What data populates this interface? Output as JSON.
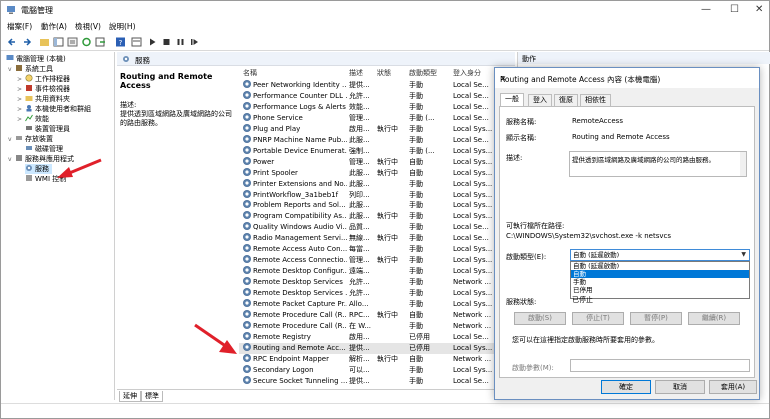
{
  "window": {
    "title": "電腦管理"
  },
  "menu": [
    "檔案(F)",
    "動作(A)",
    "檢視(V)",
    "說明(H)"
  ],
  "tree": [
    {
      "label": "電腦管理 (本機)",
      "indent": 0,
      "caret": ""
    },
    {
      "label": "系統工具",
      "indent": 1,
      "caret": "v"
    },
    {
      "label": "工作排程器",
      "indent": 2,
      "caret": ">"
    },
    {
      "label": "事件檢視器",
      "indent": 2,
      "caret": ">"
    },
    {
      "label": "共用資料夾",
      "indent": 2,
      "caret": ">"
    },
    {
      "label": "本機使用者和群組",
      "indent": 2,
      "caret": ">"
    },
    {
      "label": "效能",
      "indent": 2,
      "caret": ">"
    },
    {
      "label": "裝置管理員",
      "indent": 2,
      "caret": ""
    },
    {
      "label": "存放裝置",
      "indent": 1,
      "caret": "v"
    },
    {
      "label": "磁碟管理",
      "indent": 2,
      "caret": ""
    },
    {
      "label": "服務與應用程式",
      "indent": 1,
      "caret": "v"
    },
    {
      "label": "服務",
      "indent": 2,
      "caret": "",
      "selected": true
    },
    {
      "label": "WMI 控制",
      "indent": 2,
      "caret": ""
    }
  ],
  "services_header": "服務",
  "detail": {
    "title": "Routing and Remote Access",
    "desc_label": "描述:",
    "desc_text": "提供透到區域網路及廣域網路的公司的路由服務。"
  },
  "columns": [
    "名稱",
    "描述",
    "狀態",
    "啟動類型",
    "登入身分"
  ],
  "rows": [
    [
      "Peer Networking Identity ...",
      "提供...",
      "",
      "手動",
      "Local Se..."
    ],
    [
      "Performance Counter DLL ...",
      "允許...",
      "",
      "手動",
      "Local Se..."
    ],
    [
      "Performance Logs & Alerts",
      "效能...",
      "",
      "手動",
      "Local Se..."
    ],
    [
      "Phone Service",
      "管理...",
      "",
      "手動 (...",
      "Local Se..."
    ],
    [
      "Plug and Play",
      "啟用...",
      "執行中",
      "手動",
      "Local Sys..."
    ],
    [
      "PNRP Machine Name Pub...",
      "此服...",
      "",
      "手動",
      "Local Se..."
    ],
    [
      "Portable Device Enumerat...",
      "強制...",
      "",
      "手動 (...",
      "Local Sys..."
    ],
    [
      "Power",
      "管理...",
      "執行中",
      "自動",
      "Local Sys..."
    ],
    [
      "Print Spooler",
      "此服...",
      "執行中",
      "自動",
      "Local Sys..."
    ],
    [
      "Printer Extensions and No...",
      "此服...",
      "",
      "手動",
      "Local Sys..."
    ],
    [
      "PrintWorkflow_3a1beb1f",
      "列印...",
      "",
      "手動",
      "Local Sys..."
    ],
    [
      "Problem Reports and Sol...",
      "此服...",
      "",
      "手動",
      "Local Sys..."
    ],
    [
      "Program Compatibility As...",
      "此服...",
      "執行中",
      "手動",
      "Local Sys..."
    ],
    [
      "Quality Windows Audio Vi...",
      "品質...",
      "",
      "手動",
      "Local Se..."
    ],
    [
      "Radio Management Servi...",
      "無線...",
      "執行中",
      "手動",
      "Local Se..."
    ],
    [
      "Remote Access Auto Con...",
      "每當...",
      "",
      "手動",
      "Local Sys..."
    ],
    [
      "Remote Access Connectio...",
      "管理...",
      "執行中",
      "手動",
      "Local Sys..."
    ],
    [
      "Remote Desktop Configur...",
      "遠端...",
      "",
      "手動",
      "Local Sys..."
    ],
    [
      "Remote Desktop Services",
      "允許...",
      "",
      "手動",
      "Network ..."
    ],
    [
      "Remote Desktop Services ...",
      "允許...",
      "",
      "手動",
      "Local Sys..."
    ],
    [
      "Remote Packet Capture Pr...",
      "Allo...",
      "",
      "手動",
      "Local Sys..."
    ],
    [
      "Remote Procedure Call (R...",
      "RPC...",
      "執行中",
      "自動",
      "Network ..."
    ],
    [
      "Remote Procedure Call (R...",
      "在 W...",
      "",
      "手動",
      "Network ..."
    ],
    [
      "Remote Registry",
      "啟用...",
      "",
      "已停用",
      "Local Se..."
    ],
    [
      "Routing and Remote Acc...",
      "提供...",
      "",
      "已停用",
      "Local Sys..."
    ],
    [
      "RPC Endpoint Mapper",
      "解析...",
      "執行中",
      "自動",
      "Network ..."
    ],
    [
      "Secondary Logon",
      "可以...",
      "",
      "手動",
      "Local Sys..."
    ],
    [
      "Secure Socket Tunneling ...",
      "提供...",
      "",
      "手動",
      "Local Se..."
    ]
  ],
  "bottom_tabs": [
    "延伸",
    "標準"
  ],
  "actions_header": "動作",
  "dialog": {
    "title": "Routing and Remote Access 內容 (本機電腦)",
    "tabs": [
      "一般",
      "登入",
      "復原",
      "相依性"
    ],
    "service_name_label": "服務名稱:",
    "service_name": "RemoteAccess",
    "display_name_label": "顯示名稱:",
    "display_name": "Routing and Remote Access",
    "desc_label": "描述:",
    "desc_text": "提供透到區域網路及廣域網路的公司的路由服務。",
    "exe_label": "可執行檔所在路徑:",
    "exe_path": "C:\\WINDOWS\\System32\\svchost.exe -k netsvcs",
    "startup_label": "啟動類型(E):",
    "startup_value": "自動 (延遲啟動)",
    "startup_options": [
      "自動 (延遲啟動)",
      "自動",
      "手動",
      "已停用"
    ],
    "status_label": "服務狀態:",
    "status_value": "已停止",
    "start_btn": "啟動(S)",
    "stop_btn": "停止(T)",
    "pause_btn": "暫停(P)",
    "resume_btn": "繼續(R)",
    "hint": "您可以在這裡指定啟動服務時所要套用的參數。",
    "params_label": "啟動參數(M):",
    "ok": "確定",
    "cancel": "取消",
    "apply": "套用(A)"
  },
  "colors": {
    "accent": "#0078d7",
    "arrow": "#e0202a",
    "selection": "#cce8ff"
  }
}
